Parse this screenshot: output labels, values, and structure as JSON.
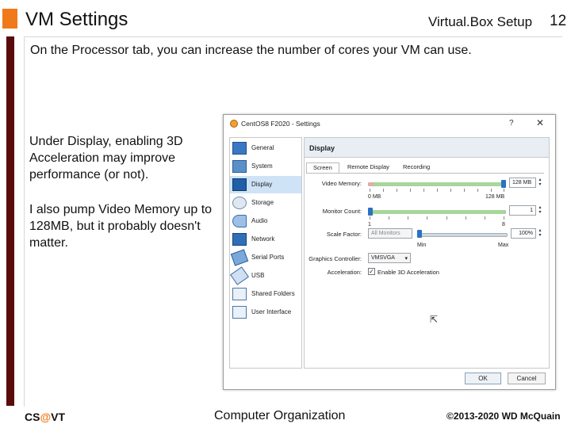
{
  "slide": {
    "title": "VM Settings",
    "header_right": "Virtual.Box Setup",
    "page_number": "12",
    "intro": "On the Processor tab, you can increase the number of cores your VM can use.",
    "para1": "Under Display, enabling 3D Acceleration may improve performance (or not).",
    "para2": "I also pump Video Memory up to 128MB, but it probably doesn't matter.",
    "footer_left_pre": "CS",
    "footer_left_at": "@",
    "footer_left_post": "VT",
    "footer_mid": "Computer Organization",
    "footer_right": "©2013-2020 WD McQuain",
    "accent_color": "#f07a1a",
    "bar_color": "#5a0a0a"
  },
  "dialog": {
    "title": "CentOS8 F2020 - Settings",
    "help": "?",
    "close": "✕",
    "sidebar": [
      {
        "label": "General",
        "icon": "general-icon"
      },
      {
        "label": "System",
        "icon": "system-icon"
      },
      {
        "label": "Display",
        "icon": "display-icon",
        "selected": true
      },
      {
        "label": "Storage",
        "icon": "storage-icon"
      },
      {
        "label": "Audio",
        "icon": "audio-icon"
      },
      {
        "label": "Network",
        "icon": "network-icon"
      },
      {
        "label": "Serial Ports",
        "icon": "serial-ports-icon"
      },
      {
        "label": "USB",
        "icon": "usb-icon"
      },
      {
        "label": "Shared Folders",
        "icon": "shared-folders-icon"
      },
      {
        "label": "User Interface",
        "icon": "user-interface-icon"
      }
    ],
    "section_title": "Display",
    "tabs": [
      "Screen",
      "Remote Display",
      "Recording"
    ],
    "video_memory": {
      "label": "Video Memory:",
      "value": "128 MB",
      "min": "0 MB",
      "max": "128 MB",
      "fraction": 1.0
    },
    "monitor_count": {
      "label": "Monitor Count:",
      "value": "1",
      "min": "1",
      "max": "8",
      "fraction": 0.0
    },
    "scale_factor": {
      "label": "Scale Factor:",
      "combo": "All Monitors",
      "value": "100%",
      "min": "Min",
      "max": "Max",
      "fraction": 0.0
    },
    "graphics_controller": {
      "label": "Graphics Controller:",
      "value": "VMSVGA"
    },
    "acceleration": {
      "label": "Acceleration:",
      "checkbox_label": "Enable 3D Acceleration",
      "checked": true
    },
    "ok_label": "OK",
    "cancel_label": "Cancel"
  }
}
